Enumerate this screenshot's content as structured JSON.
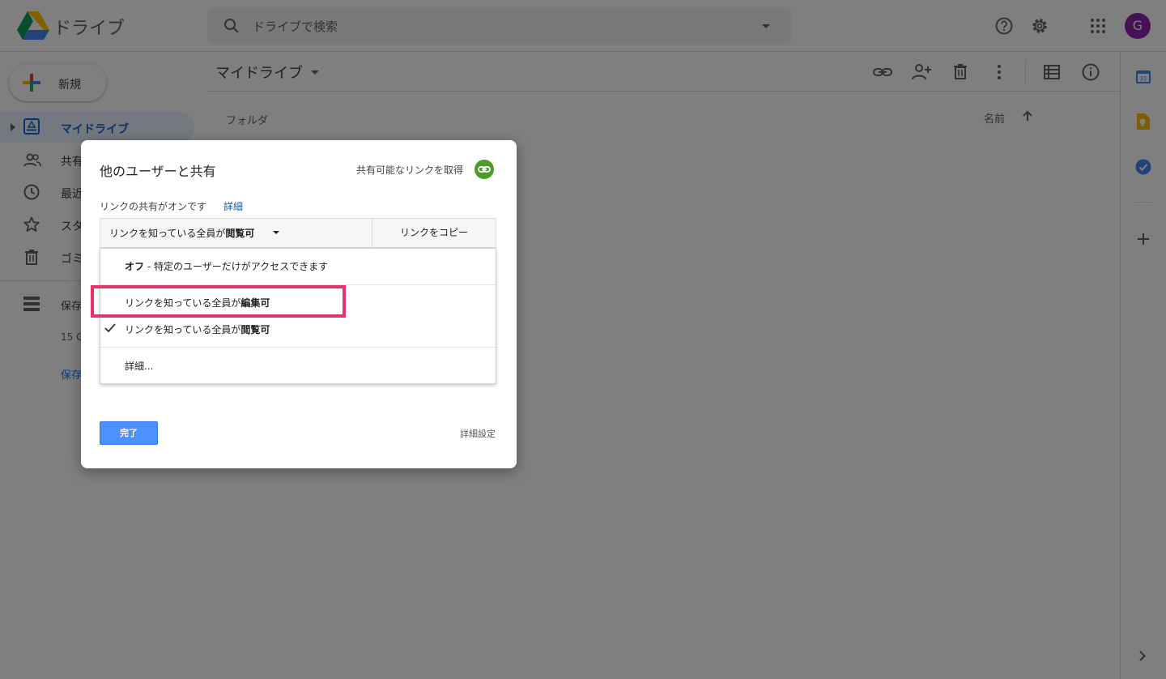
{
  "app": {
    "title": "ドライブ"
  },
  "search": {
    "placeholder": "ドライブで検索"
  },
  "header": {
    "avatar_letter": "G"
  },
  "sidebar": {
    "new_label": "新規",
    "items": [
      {
        "label": "マイドライブ",
        "icon": "my-drive-icon",
        "active": true
      },
      {
        "label": "共有",
        "icon": "people-icon"
      },
      {
        "label": "最近",
        "icon": "clock-icon"
      },
      {
        "label": "スタ",
        "icon": "star-icon"
      },
      {
        "label": "ゴミ",
        "icon": "trash-icon"
      }
    ],
    "storage_label": "保存",
    "storage_usage": "15 G",
    "storage_buy": "保存"
  },
  "main": {
    "title": "マイドライブ",
    "folder_header": "フォルダ",
    "sort_label": "名前"
  },
  "dialog": {
    "title": "他のユーザーと共有",
    "get_link": "共有可能なリンクを取得",
    "status": "リンクの共有がオンです",
    "details_link": "詳細",
    "permission_prefix": "リンクを知っている全員が",
    "permission_value": "閲覧可",
    "copy_button": "リンクをコピー",
    "menu": {
      "off_label": "オフ",
      "off_desc": " - 特定のユーザーだけがアクセスできます",
      "edit_prefix": "リンクを知っている全員が",
      "edit_value": "編集可",
      "view_prefix": "リンクを知っている全員が",
      "view_value": "閲覧可",
      "more": "詳細..."
    },
    "done_button": "完了",
    "advanced": "詳細設定"
  },
  "colors": {
    "accent": "#1a73e8",
    "highlight_box": "#e8336a",
    "done_button": "#4d90fe",
    "link_icon_bg": "#4e9a2c",
    "avatar_bg": "#8e24aa"
  }
}
